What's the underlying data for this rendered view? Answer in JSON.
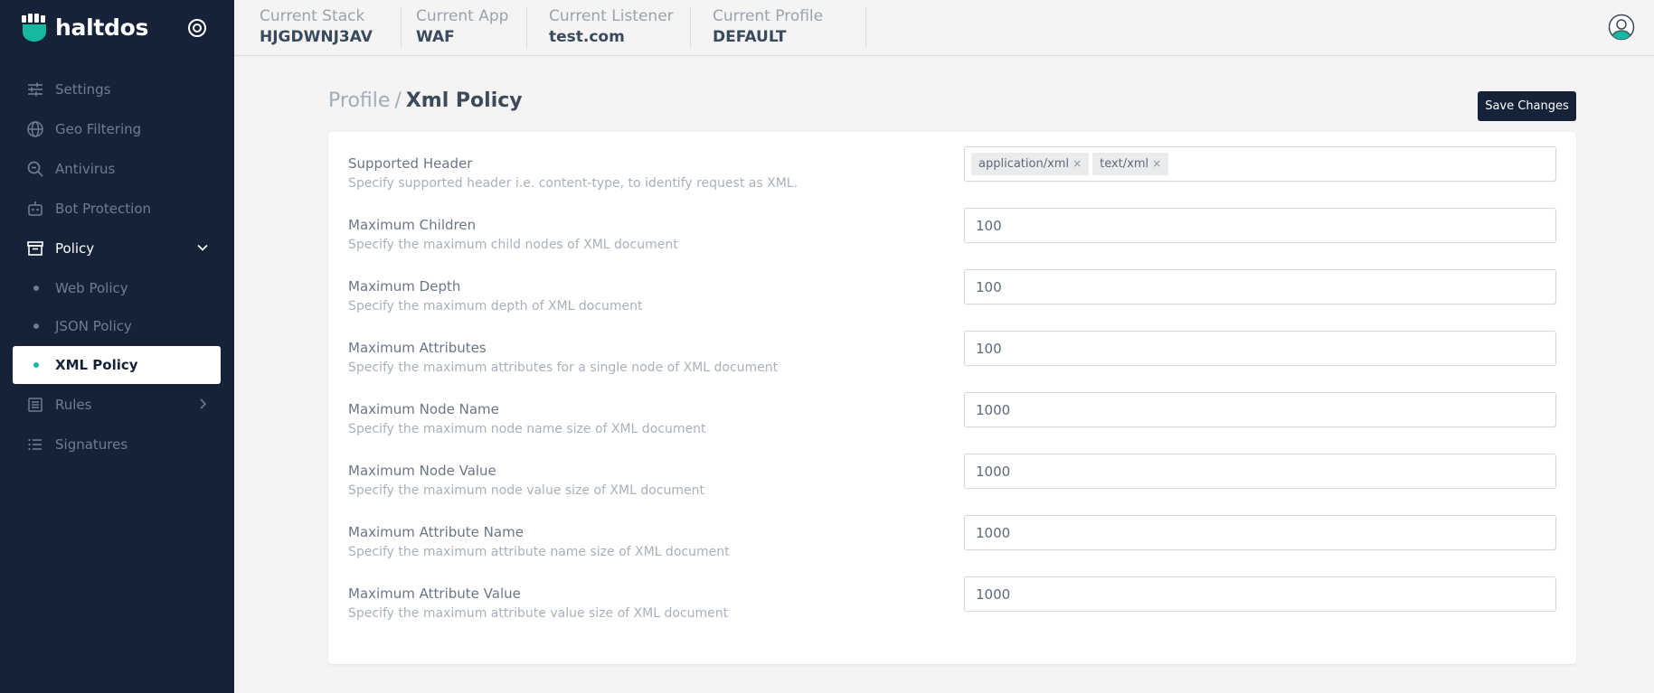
{
  "brand": {
    "name": "haltdos",
    "accent": "#17b8a0",
    "sidebar_bg": "#152238"
  },
  "topbar": {
    "contexts": [
      {
        "label": "Current Stack",
        "value": "HJGDWNJ3AV"
      },
      {
        "label": "Current App",
        "value": "WAF"
      },
      {
        "label": "Current Listener",
        "value": "test.com"
      },
      {
        "label": "Current Profile",
        "value": "DEFAULT"
      }
    ],
    "avatar_icon": "user-circle-icon"
  },
  "sidebar": {
    "items": [
      {
        "label": "Settings",
        "icon": "sliders-icon"
      },
      {
        "label": "Geo Filtering",
        "icon": "globe-icon"
      },
      {
        "label": "Antivirus",
        "icon": "search-icon"
      },
      {
        "label": "Bot Protection",
        "icon": "robot-icon"
      },
      {
        "label": "Policy",
        "icon": "archive-icon",
        "expanded": true,
        "children": [
          {
            "label": "Web Policy"
          },
          {
            "label": "JSON Policy"
          },
          {
            "label": "XML Policy",
            "selected": true
          }
        ]
      },
      {
        "label": "Rules",
        "icon": "list-box-icon"
      },
      {
        "label": "Signatures",
        "icon": "list-icon"
      }
    ]
  },
  "page": {
    "breadcrumb_parent": "Profile",
    "breadcrumb_sep": "/",
    "title": "Xml Policy",
    "save_label": "Save Changes"
  },
  "settings": {
    "supported_header": {
      "title": "Supported Header",
      "desc": "Specify supported header i.e. content-type, to identify request as XML.",
      "tags": [
        "application/xml",
        "text/xml"
      ],
      "remove_glyph": "×"
    },
    "max_children": {
      "title": "Maximum Children",
      "desc": "Specify the maximum child nodes of XML document",
      "value": "100"
    },
    "max_depth": {
      "title": "Maximum Depth",
      "desc": "Specify the maximum depth of XML document",
      "value": "100"
    },
    "max_attributes": {
      "title": "Maximum Attributes",
      "desc": "Specify the maximum attributes for a single node of XML document",
      "value": "100"
    },
    "max_node_name": {
      "title": "Maximum Node Name",
      "desc": "Specify the maximum node name size of XML document",
      "value": "1000"
    },
    "max_node_value": {
      "title": "Maximum Node Value",
      "desc": "Specify the maximum node value size of XML document",
      "value": "1000"
    },
    "max_attr_name": {
      "title": "Maximum Attribute Name",
      "desc": "Specify the maximum attribute name size of XML document",
      "value": "1000"
    },
    "max_attr_value": {
      "title": "Maximum Attribute Value",
      "desc": "Specify the maximum attribute value size of XML document",
      "value": "1000"
    }
  }
}
